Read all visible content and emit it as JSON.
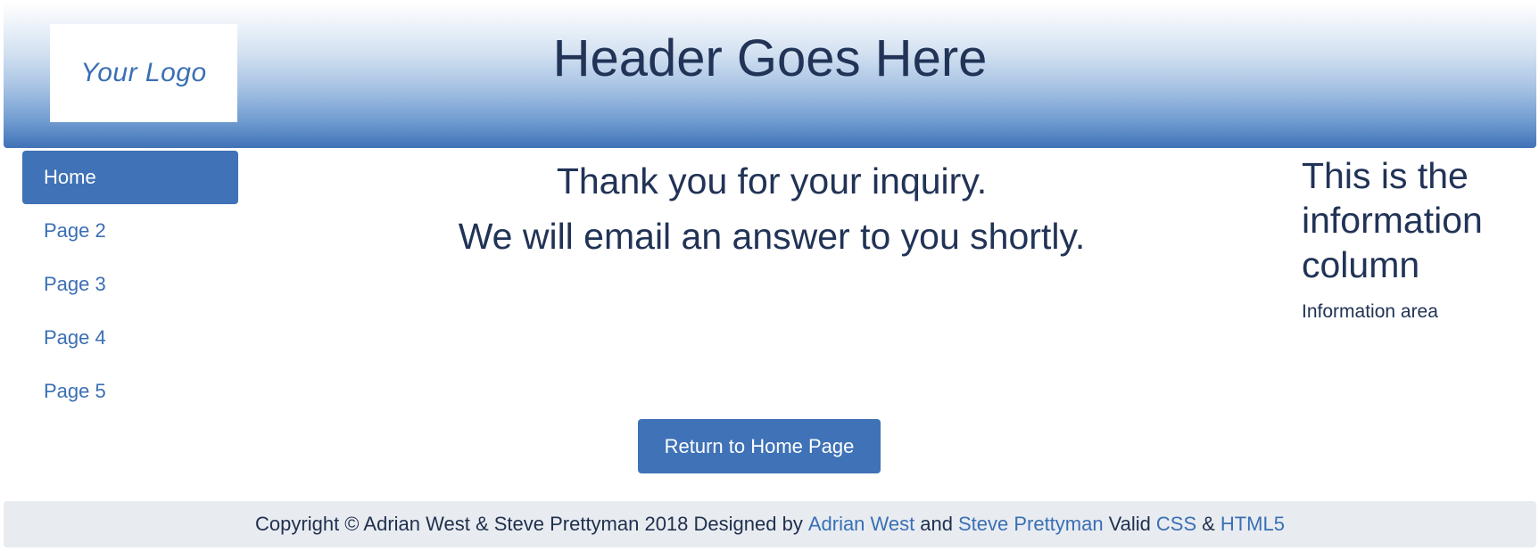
{
  "header": {
    "logo_text": "Your Logo",
    "title": "Header Goes Here"
  },
  "nav": {
    "items": [
      {
        "label": "Home",
        "active": true
      },
      {
        "label": "Page 2",
        "active": false
      },
      {
        "label": "Page 3",
        "active": false
      },
      {
        "label": "Page 4",
        "active": false
      },
      {
        "label": "Page 5",
        "active": false
      }
    ]
  },
  "main": {
    "line1": "Thank you for your inquiry.",
    "line2": "We will email an answer to you shortly.",
    "return_button_label": "Return to Home Page"
  },
  "info": {
    "title": "This is the information column",
    "text": "Information area"
  },
  "footer": {
    "copyright": "Copyright © Adrian West & Steve Prettyman 2018 Designed by",
    "link_adrian": "Adrian West",
    "and_text": "and",
    "link_steve": "Steve Prettyman",
    "valid_text": "Valid",
    "link_css": "CSS",
    "amp_text": "&",
    "link_html5": "HTML5"
  },
  "colors": {
    "brand_blue": "#3f72b6",
    "link_blue": "#3a6fb4",
    "text_dark": "#213356",
    "footer_bg": "#e8ecf1"
  }
}
